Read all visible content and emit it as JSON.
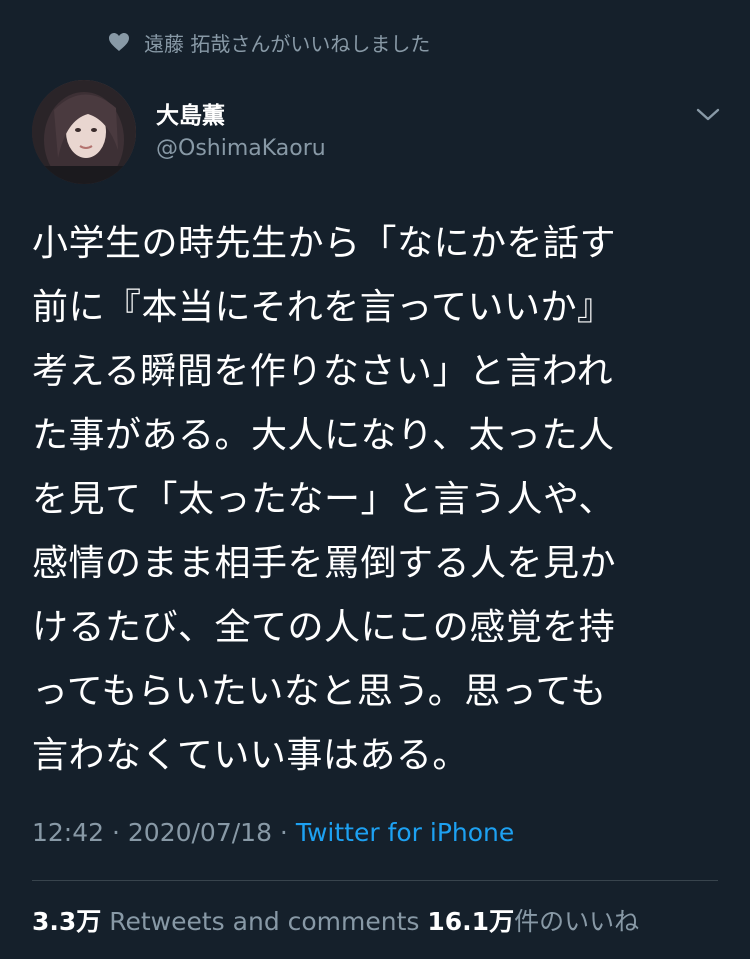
{
  "liked_by": {
    "icon": "heart-icon",
    "text": "遠藤 拓哉さんがいいねしました"
  },
  "author": {
    "name": "大島薫",
    "handle": "@OshimaKaoru"
  },
  "tweet": {
    "lines": [
      "小学生の時先生から「なにかを話す",
      "前に『本当にそれを言っていいか』",
      "考える瞬間を作りなさい」と言われ",
      "た事がある。大人になり、太った人",
      "を見て「太ったなー」と言う人や、",
      "感情のまま相手を罵倒する人を見か",
      "けるたび、全ての人にこの感覚を持",
      "ってもらいたいなと思う。思っても",
      "言わなくていい事はある。"
    ]
  },
  "meta": {
    "time": "12:42",
    "separator1": " · ",
    "date": "2020/07/18",
    "separator2": " · ",
    "source": "Twitter for iPhone"
  },
  "stats": {
    "retweets_count": "3.3万",
    "retweets_label": " Retweets and comments ",
    "likes_count": "16.1万",
    "likes_label": "件のいいね"
  },
  "colors": {
    "background": "#15202b",
    "text_primary": "#ffffff",
    "text_secondary": "#8899a6",
    "link": "#1da1f2",
    "divider": "#38444d"
  }
}
